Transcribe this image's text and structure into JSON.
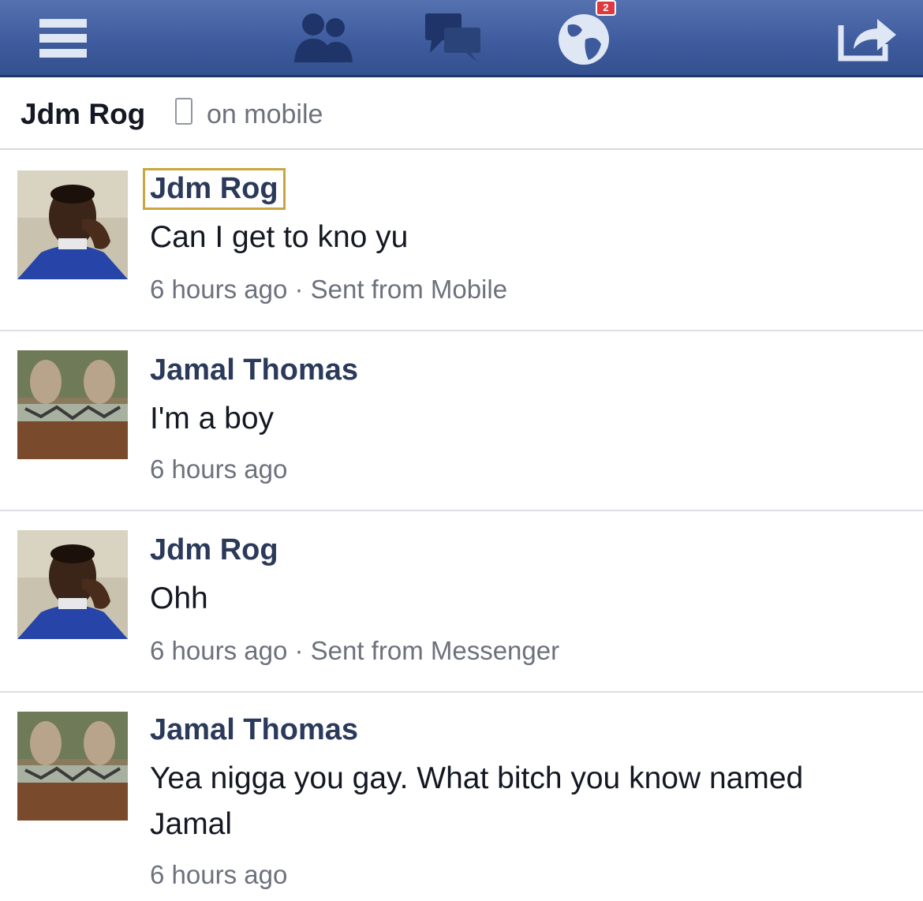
{
  "topbar": {
    "icons": [
      "menu-icon",
      "friend-requests-icon",
      "messages-icon",
      "notifications-globe-icon",
      "share-icon"
    ],
    "notification_count": "2",
    "accent_color": "#3d5a9c"
  },
  "conversation": {
    "title": "Jdm Rog",
    "status": "on mobile"
  },
  "messages": [
    {
      "sender": "Jdm Rog",
      "text": "Can I get to kno yu",
      "time": "6 hours ago · Sent from Mobile"
    },
    {
      "sender": "Jamal Thomas",
      "text": "I'm a boy",
      "time": "6 hours ago"
    },
    {
      "sender": "Jdm Rog",
      "text": "Ohh",
      "time": "6 hours ago · Sent from Messenger"
    },
    {
      "sender": "Jamal Thomas",
      "text": "Yea nigga you gay. What bitch you know named Jamal",
      "time": "6 hours ago"
    }
  ]
}
